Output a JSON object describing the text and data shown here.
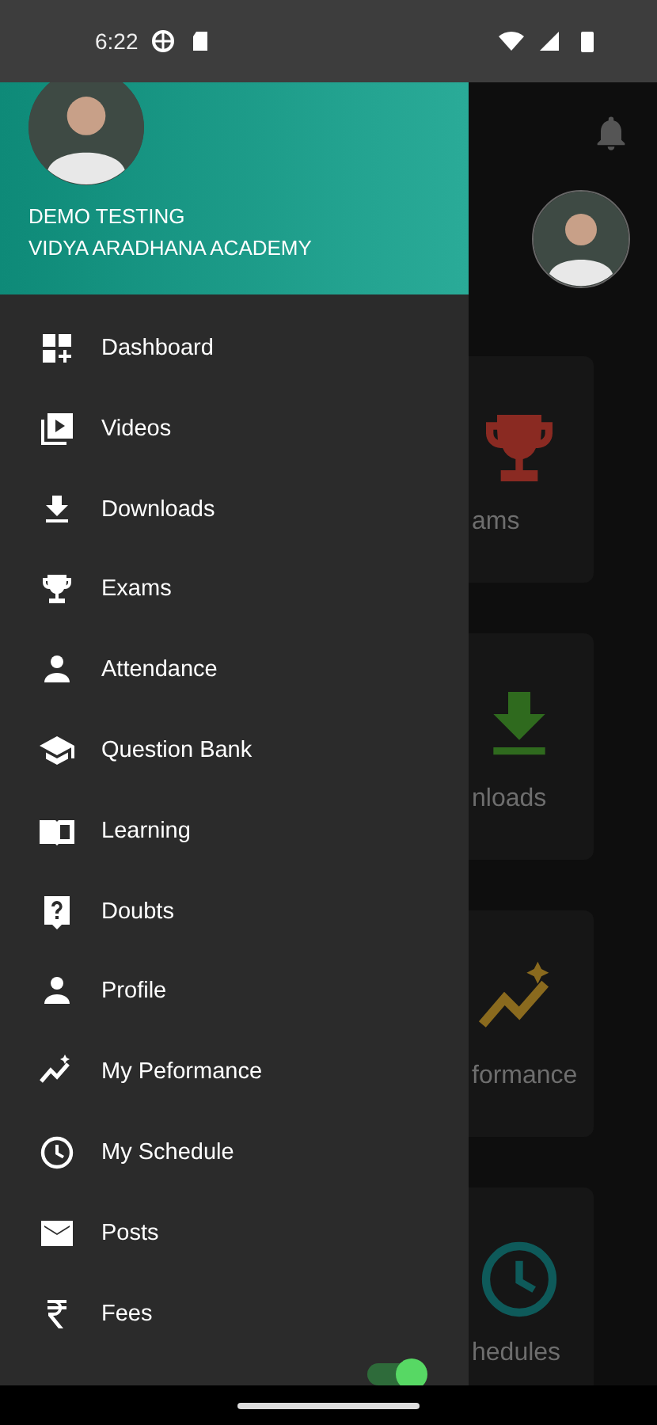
{
  "status_bar": {
    "time": "6:22"
  },
  "drawer": {
    "user_name": "DEMO TESTING",
    "institute": "VIDYA ARADHANA ACADEMY",
    "items": [
      {
        "label": "Dashboard"
      },
      {
        "label": "Videos"
      },
      {
        "label": "Downloads"
      },
      {
        "label": "Exams"
      },
      {
        "label": "Attendance"
      },
      {
        "label": "Question Bank"
      },
      {
        "label": "Learning"
      },
      {
        "label": "Doubts"
      },
      {
        "label": "Profile"
      },
      {
        "label": "My Peformance"
      },
      {
        "label": "My Schedule"
      },
      {
        "label": "Posts"
      },
      {
        "label": "Fees"
      }
    ],
    "partial_toggle": {
      "on": true
    }
  },
  "background_cards": [
    {
      "label": "ams"
    },
    {
      "label": "nloads"
    },
    {
      "label": "formance"
    },
    {
      "label": "hedules"
    }
  ]
}
